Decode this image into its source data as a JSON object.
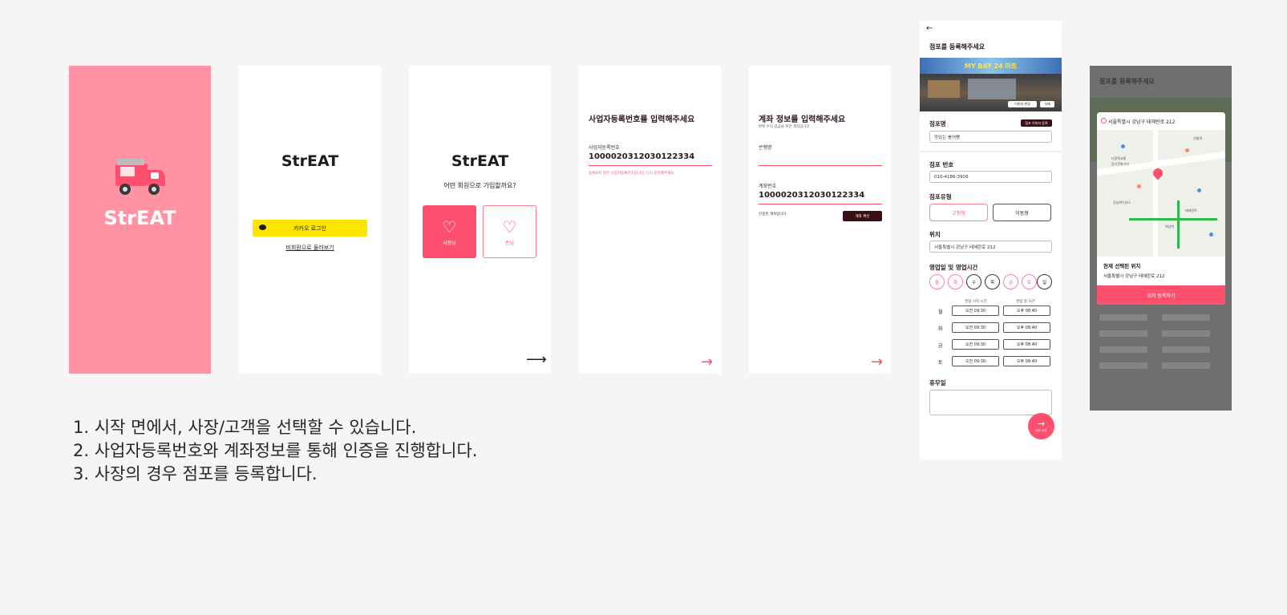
{
  "colors": {
    "background": "#f5f5f5",
    "brand_pink": "#ff93a3",
    "accent": "#ff4f6e",
    "kakao_yellow": "#fee500",
    "dark_button": "#3a1014"
  },
  "splash": {
    "logo_text": "StrEAT",
    "icon": "food-truck-icon"
  },
  "login": {
    "brand": "StrEAT",
    "kakao_label": "카카오 로그인",
    "guest_label": "비회원으로 둘러보기"
  },
  "member_type": {
    "brand": "StrEAT",
    "question": "어떤 회원으로 가입할까요?",
    "owner_label": "사장님",
    "customer_label": "손님",
    "next_icon": "arrow-right-icon"
  },
  "business": {
    "title": "사업자등록번호를 입력해주세요",
    "label": "사업자등록번호",
    "value": "1000020312030122334",
    "error": "등록되지 않은 사업자등록번호입니다. 다시 입력해주세요."
  },
  "account": {
    "title": "계좌 정보를 입력해주세요",
    "subtitle": "판매 수익 입금을 위한 계좌입니다",
    "bank_label": "은행명",
    "account_label": "계좌번호",
    "account_value": "1000020312030122334",
    "status_note": "인증된 계좌입니다.",
    "verify_label": "계좌 확인"
  },
  "store": {
    "back_icon": "back-arrow-icon",
    "title": "점포를 등록해주세요",
    "photo_sign": "MY BAY 24 마트",
    "change_photo": "이미지 변경",
    "delete_photo": "삭제",
    "name_label": "점포명",
    "register_image": "점포 이미지 등록",
    "name_value": "맛있는 붕어빵",
    "phone_label": "점포 번호",
    "phone_value": "010-4186-3909",
    "type_label": "점포유형",
    "type_fixed": "고정형",
    "type_mobile": "이동형",
    "location_label": "위치",
    "location_value": "서울특별시 강남구 테헤란로 212",
    "hours_label": "영업일 및 영업시간",
    "days": [
      {
        "label": "월",
        "on": true
      },
      {
        "label": "화",
        "on": true
      },
      {
        "label": "수",
        "on": false
      },
      {
        "label": "목",
        "on": false
      },
      {
        "label": "금",
        "on": true
      },
      {
        "label": "토",
        "on": true
      },
      {
        "label": "일",
        "on": false
      }
    ],
    "open_head": "영업 시작 시간",
    "close_head": "영업 끝 시간",
    "hours": [
      {
        "day": "월",
        "open": "오전 09:30",
        "close": "오후 08:40"
      },
      {
        "day": "화",
        "open": "오전 09:30",
        "close": "오후 08:40"
      },
      {
        "day": "금",
        "open": "오전 09:30",
        "close": "오후 08:40"
      },
      {
        "day": "토",
        "open": "오전 09:30",
        "close": "오후 08:40"
      }
    ],
    "closed_label": "휴무일",
    "next_label": "점포 저장"
  },
  "location_picker": {
    "faded_title": "점포를 등록해주세요",
    "search_value": "서울특별시 강남구 테헤란로 212",
    "current_label": "현재 선택된 위치",
    "current_address": "서울특별시 강남구 테헤란로 212",
    "register_label": "위치 등록하기",
    "map_labels": [
      "다람쥐교통",
      "음식문화거리",
      "역삼역",
      "선릉역",
      "강남파이낸스",
      "테헤란로"
    ]
  },
  "captions": [
    "1. 시작 면에서, 사장/고객을 선택할 수 있습니다.",
    "2. 사업자등록번호와 계좌정보를 통해 인증을 진행합니다.",
    "3. 사장의 경우 점포를 등록합니다."
  ]
}
